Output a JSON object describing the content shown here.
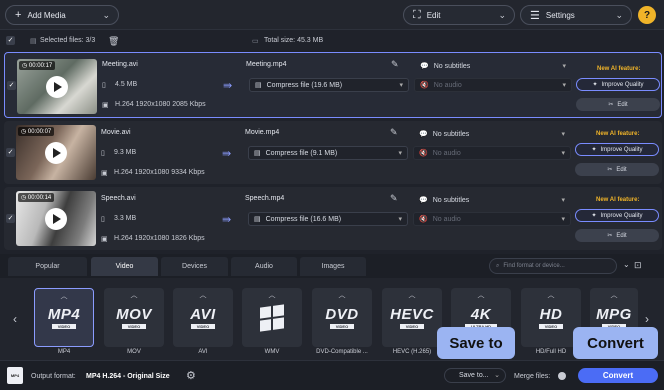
{
  "toolbar": {
    "add_media": "Add Media",
    "edit": "Edit",
    "settings": "Settings",
    "help": "?"
  },
  "selection": {
    "selected_files": "Selected files: 3/3",
    "total_size": "Total size: 45.3 MB"
  },
  "files": [
    {
      "duration": "00:00:17",
      "name": "Meeting.avi",
      "size": "4.5 MB",
      "codec": "H.264 1920x1080 2085 Kbps",
      "output_name": "Meeting.mp4",
      "compress": "Compress file (19.6 MB)",
      "subtitles": "No subtitles",
      "audio": "No audio",
      "ai_feature": "New AI feature:",
      "improve": "Improve Quality",
      "edit": "Edit"
    },
    {
      "duration": "00:00:07",
      "name": "Movie.avi",
      "size": "9.3 MB",
      "codec": "H.264 1920x1080 9334 Kbps",
      "output_name": "Movie.mp4",
      "compress": "Compress file (9.1 MB)",
      "subtitles": "No subtitles",
      "audio": "No audio",
      "ai_feature": "New AI feature:",
      "improve": "Improve Quality",
      "edit": "Edit"
    },
    {
      "duration": "00:00:14",
      "name": "Speech.avi",
      "size": "3.3 MB",
      "codec": "H.264 1920x1080 1826 Kbps",
      "output_name": "Speech.mp4",
      "compress": "Compress file (16.6 MB)",
      "subtitles": "No subtitles",
      "audio": "No audio",
      "ai_feature": "New AI feature:",
      "improve": "Improve Quality",
      "edit": "Edit"
    }
  ],
  "tabs": [
    "Popular",
    "Video",
    "Devices",
    "Audio",
    "Images"
  ],
  "search": {
    "placeholder": "Find format or device..."
  },
  "formats": [
    {
      "logo": "MP4",
      "sub": "VIDEO",
      "label": "MP4"
    },
    {
      "logo": "MOV",
      "sub": "VIDEO",
      "label": "MOV"
    },
    {
      "logo": "AVI",
      "sub": "VIDEO",
      "label": "AVI"
    },
    {
      "logo": "",
      "sub": "",
      "label": "WMV"
    },
    {
      "logo": "DVD",
      "sub": "VIDEO",
      "label": "DVD-Compatible ..."
    },
    {
      "logo": "HEVC",
      "sub": "VIDEO",
      "label": "HEVC (H.265)"
    },
    {
      "logo": "4K",
      "sub": "ULTRA HD",
      "label": ""
    },
    {
      "logo": "HD",
      "sub": "VIDEO",
      "label": "HD/Full HD"
    },
    {
      "logo": "MPG",
      "sub": "VIDEO",
      "label": ""
    }
  ],
  "tooltips": {
    "save_to": "Save to",
    "convert": "Convert"
  },
  "bottom": {
    "output_format": "Output format:",
    "output_value": "MP4 H.264 - Original Size",
    "save_to": "Save to...",
    "merge_files": "Merge files:",
    "convert": "Convert"
  },
  "colors": {
    "accent": "#4b6cf5",
    "highlight": "#9bb4f2",
    "ai": "#f0b429"
  }
}
